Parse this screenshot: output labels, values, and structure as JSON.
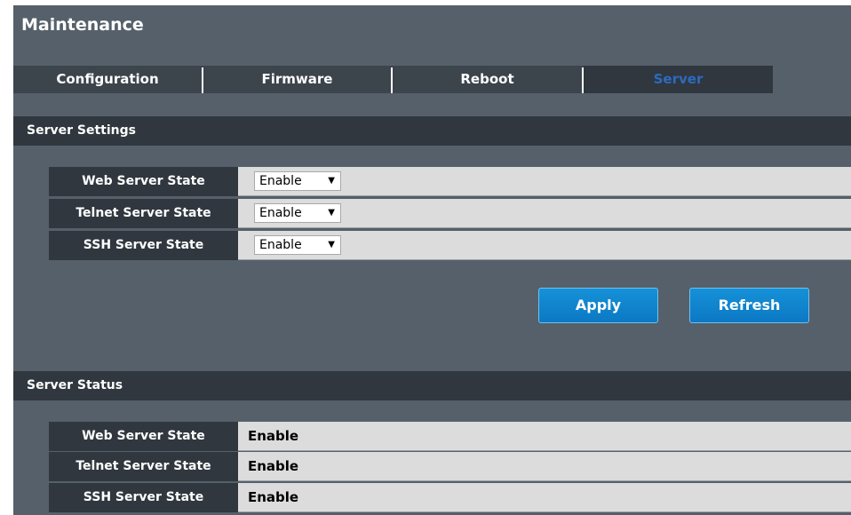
{
  "page": {
    "title": "Maintenance"
  },
  "tabs": [
    {
      "label": "Configuration"
    },
    {
      "label": "Firmware"
    },
    {
      "label": "Reboot"
    },
    {
      "label": "Server",
      "active": true
    }
  ],
  "settings": {
    "header": "Server Settings",
    "rows": [
      {
        "label": "Web Server State",
        "value": "Enable"
      },
      {
        "label": "Telnet Server State",
        "value": "Enable"
      },
      {
        "label": "SSH Server State",
        "value": "Enable"
      }
    ],
    "dropdown_arrow": "▼"
  },
  "buttons": {
    "apply": "Apply",
    "refresh": "Refresh"
  },
  "status": {
    "header": "Server Status",
    "rows": [
      {
        "label": "Web Server State",
        "value": "Enable"
      },
      {
        "label": "Telnet Server State",
        "value": "Enable"
      },
      {
        "label": "SSH Server State",
        "value": "Enable"
      }
    ]
  },
  "colors": {
    "panel_bg": "#56606a",
    "header_bg": "#30373e",
    "active_tab_text": "#2b6bc0",
    "button_blue": "#1591d8",
    "value_bg": "#dcdcdc"
  }
}
